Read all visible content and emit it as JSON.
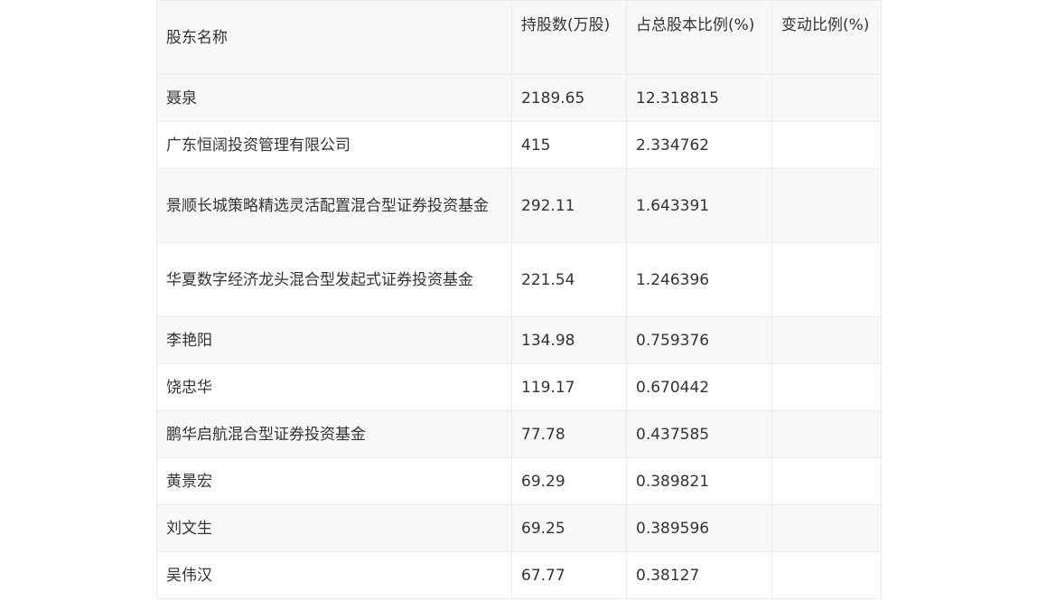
{
  "table": {
    "headers": [
      "股东名称",
      "持股数(万股)",
      "占总股本比例(%)",
      "变动比例(%)"
    ],
    "rows": [
      {
        "name": "聂泉",
        "shares": "2189.65",
        "ratio": "12.318815",
        "change": ""
      },
      {
        "name": "广东恒阔投资管理有限公司",
        "shares": "415",
        "ratio": "2.334762",
        "change": ""
      },
      {
        "name": "景顺长城策略精选灵活配置混合型证券投资基金",
        "shares": "292.11",
        "ratio": "1.643391",
        "change": ""
      },
      {
        "name": "华夏数字经济龙头混合型发起式证券投资基金",
        "shares": "221.54",
        "ratio": "1.246396",
        "change": ""
      },
      {
        "name": "李艳阳",
        "shares": "134.98",
        "ratio": "0.759376",
        "change": ""
      },
      {
        "name": "饶忠华",
        "shares": "119.17",
        "ratio": "0.670442",
        "change": ""
      },
      {
        "name": "鹏华启航混合型证券投资基金",
        "shares": "77.78",
        "ratio": "0.437585",
        "change": ""
      },
      {
        "name": "黄景宏",
        "shares": "69.29",
        "ratio": "0.389821",
        "change": ""
      },
      {
        "name": "刘文生",
        "shares": "69.25",
        "ratio": "0.389596",
        "change": ""
      },
      {
        "name": "吴伟汉",
        "shares": "67.77",
        "ratio": "0.38127",
        "change": ""
      }
    ]
  }
}
